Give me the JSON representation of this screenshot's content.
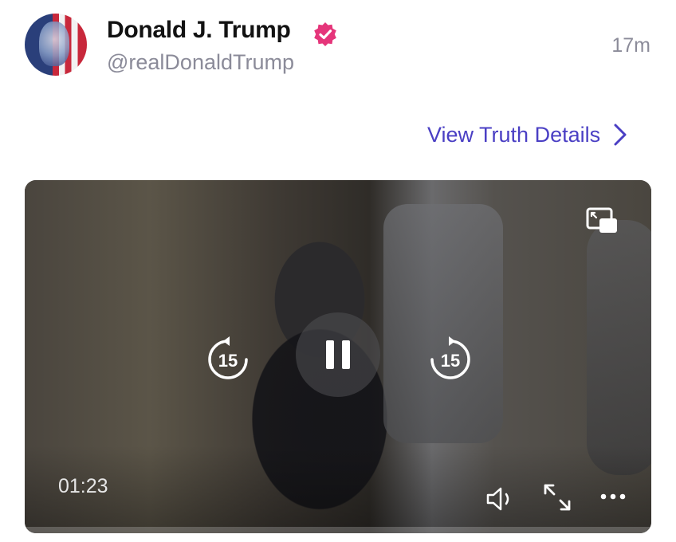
{
  "post": {
    "author": {
      "display_name": "Donald J. Trump",
      "handle": "@realDonaldTrump",
      "verified_icon": "verified-badge-icon",
      "avatar_icon": "avatar-image"
    },
    "timestamp": "17m",
    "details_link": {
      "label": "View Truth Details",
      "icon": "chevron-right-icon"
    }
  },
  "video": {
    "current_time": "01:23",
    "state": "playing",
    "skip_back_seconds": "15",
    "skip_forward_seconds": "15",
    "controls": [
      "pip-icon",
      "replay-15-icon",
      "pause-icon",
      "forward-15-icon",
      "volume-icon",
      "expand-icon",
      "more-icon"
    ]
  },
  "colors": {
    "accent": "#4a3fc4",
    "badge": "#e5357a",
    "muted_text": "#8b8b99"
  }
}
